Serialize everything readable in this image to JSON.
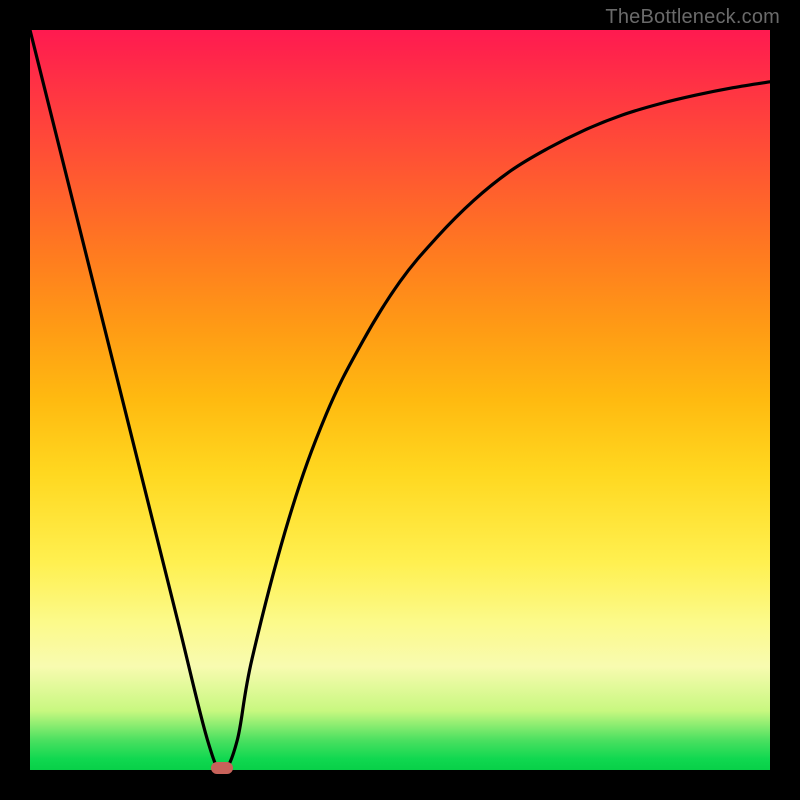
{
  "watermark": "TheBottleneck.com",
  "colors": {
    "frame": "#000000",
    "top": "#ff1a50",
    "mid": "#ffd820",
    "bottom": "#10d850",
    "curve": "#000000",
    "marker": "#c8625a"
  },
  "chart_data": {
    "type": "line",
    "title": "",
    "xlabel": "",
    "ylabel": "",
    "xlim": [
      0,
      100
    ],
    "ylim": [
      0,
      100
    ],
    "grid": false,
    "series": [
      {
        "name": "bottleneck-curve",
        "x": [
          0,
          5,
          10,
          15,
          20,
          24,
          26,
          28,
          30,
          35,
          40,
          45,
          50,
          55,
          60,
          65,
          70,
          75,
          80,
          85,
          90,
          95,
          100
        ],
        "y": [
          100,
          80,
          60,
          40,
          20,
          4,
          0,
          4,
          15,
          34,
          48,
          58,
          66,
          72,
          77,
          81,
          84,
          86.5,
          88.5,
          90,
          91.2,
          92.2,
          93
        ]
      }
    ],
    "annotations": [
      {
        "name": "minimum-marker",
        "x": 26,
        "y": 0
      }
    ]
  }
}
